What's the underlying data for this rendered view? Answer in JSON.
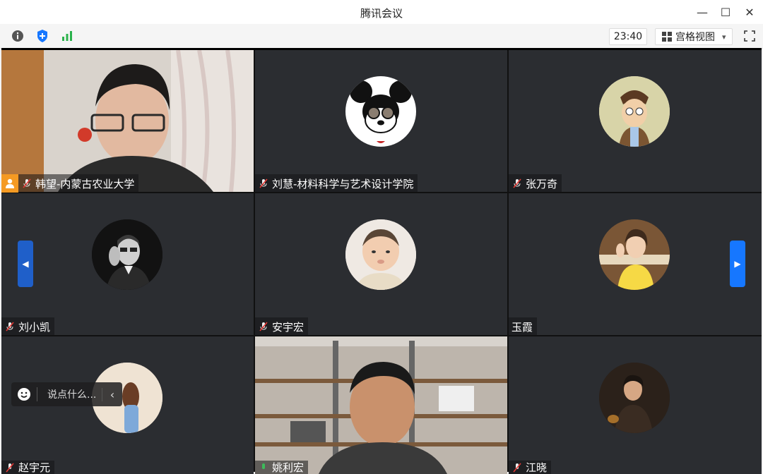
{
  "window": {
    "title": "腾讯会议",
    "minimize": "—",
    "maximize": "☐",
    "close": "✕"
  },
  "toolbar": {
    "time": "23:40",
    "view_label": "宫格视图",
    "view_caret": "▾"
  },
  "participants": [
    {
      "name": "韩望-内蒙古农业大学",
      "is_host": true,
      "mic_muted": true
    },
    {
      "name": "刘慧-材料科学与艺术设计学院",
      "is_host": false,
      "mic_muted": true
    },
    {
      "name": "张万奇",
      "is_host": false,
      "mic_muted": true
    },
    {
      "name": "刘小凯",
      "is_host": false,
      "mic_muted": true
    },
    {
      "name": "安宇宏",
      "is_host": false,
      "mic_muted": true
    },
    {
      "name": "玉霞",
      "is_host": false,
      "mic_muted": false
    },
    {
      "name": "赵宇元",
      "is_host": false,
      "mic_muted": true
    },
    {
      "name": "姚利宏",
      "is_host": false,
      "mic_muted": false
    },
    {
      "name": "江晓",
      "is_host": false,
      "mic_muted": true
    }
  ],
  "chat": {
    "placeholder": "说点什么..."
  },
  "colors": {
    "accent": "#1677ff",
    "host_badge": "#f59a23",
    "tile_bg": "#2b2d31",
    "active_outline": "#3dbb5a"
  }
}
